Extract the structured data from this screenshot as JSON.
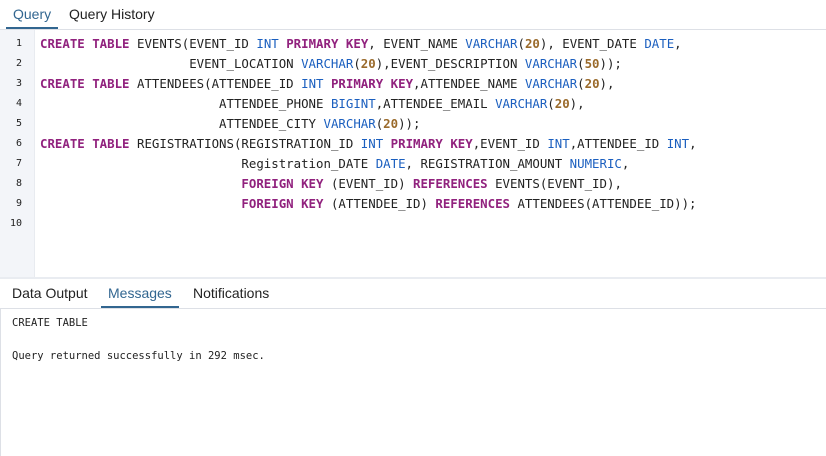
{
  "top_tabs": {
    "query": "Query",
    "query_history": "Query History"
  },
  "line_numbers": [
    "1",
    "2",
    "3",
    "4",
    "5",
    "6",
    "7",
    "8",
    "9",
    "10"
  ],
  "code_lines": [
    [
      [
        "k",
        "CREATE TABLE"
      ],
      [
        "p",
        " EVENTS(EVENT_ID "
      ],
      [
        "t",
        "INT"
      ],
      [
        "p",
        " "
      ],
      [
        "k",
        "PRIMARY KEY"
      ],
      [
        "p",
        ", EVENT_NAME "
      ],
      [
        "t",
        "VARCHAR"
      ],
      [
        "p",
        "("
      ],
      [
        "n",
        "20"
      ],
      [
        "p",
        "), EVENT_DATE "
      ],
      [
        "t",
        "DATE"
      ],
      [
        "p",
        ","
      ]
    ],
    [
      [
        "p",
        "                    EVENT_LOCATION "
      ],
      [
        "t",
        "VARCHAR"
      ],
      [
        "p",
        "("
      ],
      [
        "n",
        "20"
      ],
      [
        "p",
        "),EVENT_DESCRIPTION "
      ],
      [
        "t",
        "VARCHAR"
      ],
      [
        "p",
        "("
      ],
      [
        "n",
        "50"
      ],
      [
        "p",
        "));"
      ]
    ],
    [
      [
        "k",
        "CREATE TABLE"
      ],
      [
        "p",
        " ATTENDEES(ATTENDEE_ID "
      ],
      [
        "t",
        "INT"
      ],
      [
        "p",
        " "
      ],
      [
        "k",
        "PRIMARY KEY"
      ],
      [
        "p",
        ",ATTENDEE_NAME "
      ],
      [
        "t",
        "VARCHAR"
      ],
      [
        "p",
        "("
      ],
      [
        "n",
        "20"
      ],
      [
        "p",
        "),"
      ]
    ],
    [
      [
        "p",
        "                        ATTENDEE_PHONE "
      ],
      [
        "t",
        "BIGINT"
      ],
      [
        "p",
        ",ATTENDEE_EMAIL "
      ],
      [
        "t",
        "VARCHAR"
      ],
      [
        "p",
        "("
      ],
      [
        "n",
        "20"
      ],
      [
        "p",
        "),"
      ]
    ],
    [
      [
        "p",
        "                        ATTENDEE_CITY "
      ],
      [
        "t",
        "VARCHAR"
      ],
      [
        "p",
        "("
      ],
      [
        "n",
        "20"
      ],
      [
        "p",
        "));"
      ]
    ],
    [
      [
        "k",
        "CREATE TABLE"
      ],
      [
        "p",
        " REGISTRATIONS(REGISTRATION_ID "
      ],
      [
        "t",
        "INT"
      ],
      [
        "p",
        " "
      ],
      [
        "k",
        "PRIMARY KEY"
      ],
      [
        "p",
        ",EVENT_ID "
      ],
      [
        "t",
        "INT"
      ],
      [
        "p",
        ",ATTENDEE_ID "
      ],
      [
        "t",
        "INT"
      ],
      [
        "p",
        ","
      ]
    ],
    [
      [
        "p",
        "                           Registration_DATE "
      ],
      [
        "t",
        "DATE"
      ],
      [
        "p",
        ", REGISTRATION_AMOUNT "
      ],
      [
        "t",
        "NUMERIC"
      ],
      [
        "p",
        ","
      ]
    ],
    [
      [
        "p",
        "                           "
      ],
      [
        "k",
        "FOREIGN KEY"
      ],
      [
        "p",
        " (EVENT_ID) "
      ],
      [
        "k",
        "REFERENCES"
      ],
      [
        "p",
        " EVENTS(EVENT_ID),"
      ]
    ],
    [
      [
        "p",
        "                           "
      ],
      [
        "k",
        "FOREIGN KEY"
      ],
      [
        "p",
        " (ATTENDEE_ID) "
      ],
      [
        "k",
        "REFERENCES"
      ],
      [
        "p",
        " ATTENDEES(ATTENDEE_ID));"
      ]
    ]
  ],
  "bottom_tabs": {
    "data_output": "Data Output",
    "messages": "Messages",
    "notifications": "Notifications"
  },
  "messages": {
    "line1": "CREATE TABLE",
    "line2": "Query returned successfully in 292 msec."
  },
  "colors": {
    "active_tab": "#326690",
    "keyword": "#91227e",
    "type": "#1b5fbf",
    "number": "#9a6a2b"
  }
}
